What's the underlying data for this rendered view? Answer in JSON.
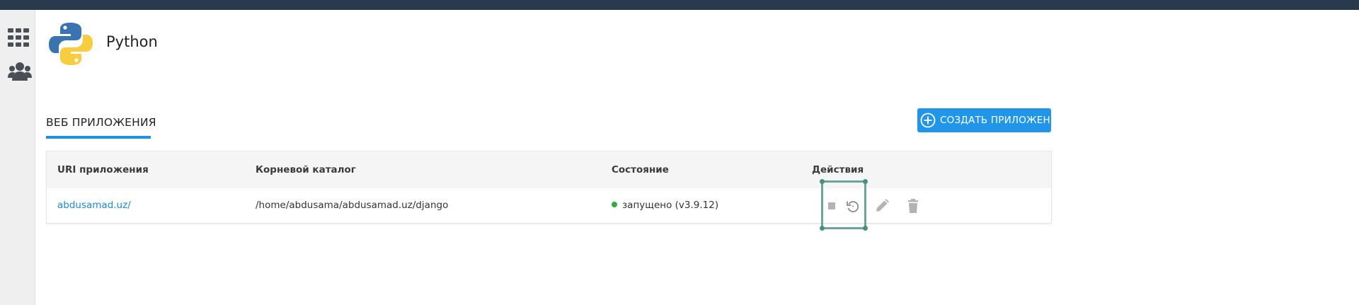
{
  "app": {
    "title": "Python"
  },
  "sidebar": {
    "items": [
      {
        "icon": "apps-grid-icon"
      },
      {
        "icon": "users-icon"
      }
    ]
  },
  "tabs": [
    {
      "label": "ВЕБ ПРИЛОЖЕНИЯ",
      "active": true
    }
  ],
  "toolbar": {
    "create_label": "СОЗДАТЬ ПРИЛОЖЕНИЕ"
  },
  "table": {
    "headers": {
      "uri": "URI приложения",
      "root": "Корневой каталог",
      "status": "Состояние",
      "actions": "Действия"
    },
    "rows": [
      {
        "uri": "abdusamad.uz/",
        "root": "/home/abdusama/abdusamad.uz/django",
        "status": "запущено (v3.9.12)",
        "status_color": "#2fae3b",
        "actions": [
          "stop-icon",
          "restart-icon",
          "edit-icon",
          "delete-icon"
        ]
      }
    ]
  },
  "colors": {
    "accent": "#2196e8",
    "topbar": "#283a4b",
    "link": "#1e88d6"
  }
}
